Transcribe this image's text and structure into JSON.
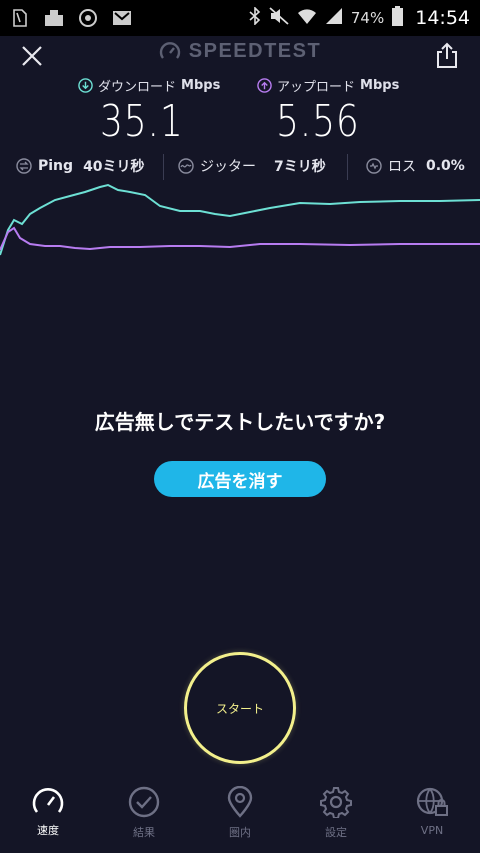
{
  "status_bar": {
    "battery": "74%",
    "time": "14:54"
  },
  "header": {
    "brand": "SPEEDTEST"
  },
  "metrics": {
    "download": {
      "label": "ダウンロード",
      "unit": "Mbps",
      "value": "35.1",
      "color": "#6de0d4"
    },
    "upload": {
      "label": "アップロード",
      "unit": "Mbps",
      "value": "5.56",
      "color": "#b77cf0"
    }
  },
  "stats": {
    "ping": {
      "label": "Ping",
      "value": "40ミリ秒"
    },
    "jitter": {
      "label": "ジッター",
      "value": "7ミリ秒"
    },
    "loss": {
      "label": "ロス",
      "value": "0.0%"
    }
  },
  "ad": {
    "question": "広告無しでテストしたいですか?",
    "button": "広告を消す"
  },
  "start": {
    "label": "スタート"
  },
  "nav": [
    {
      "label": "速度",
      "icon": "speedometer-icon",
      "active": true
    },
    {
      "label": "結果",
      "icon": "checkmark-circle-icon",
      "active": false
    },
    {
      "label": "圏内",
      "icon": "map-pin-icon",
      "active": false
    },
    {
      "label": "設定",
      "icon": "gear-icon",
      "active": false
    },
    {
      "label": "VPN",
      "icon": "vpn-globe-lock-icon",
      "active": false
    }
  ]
}
